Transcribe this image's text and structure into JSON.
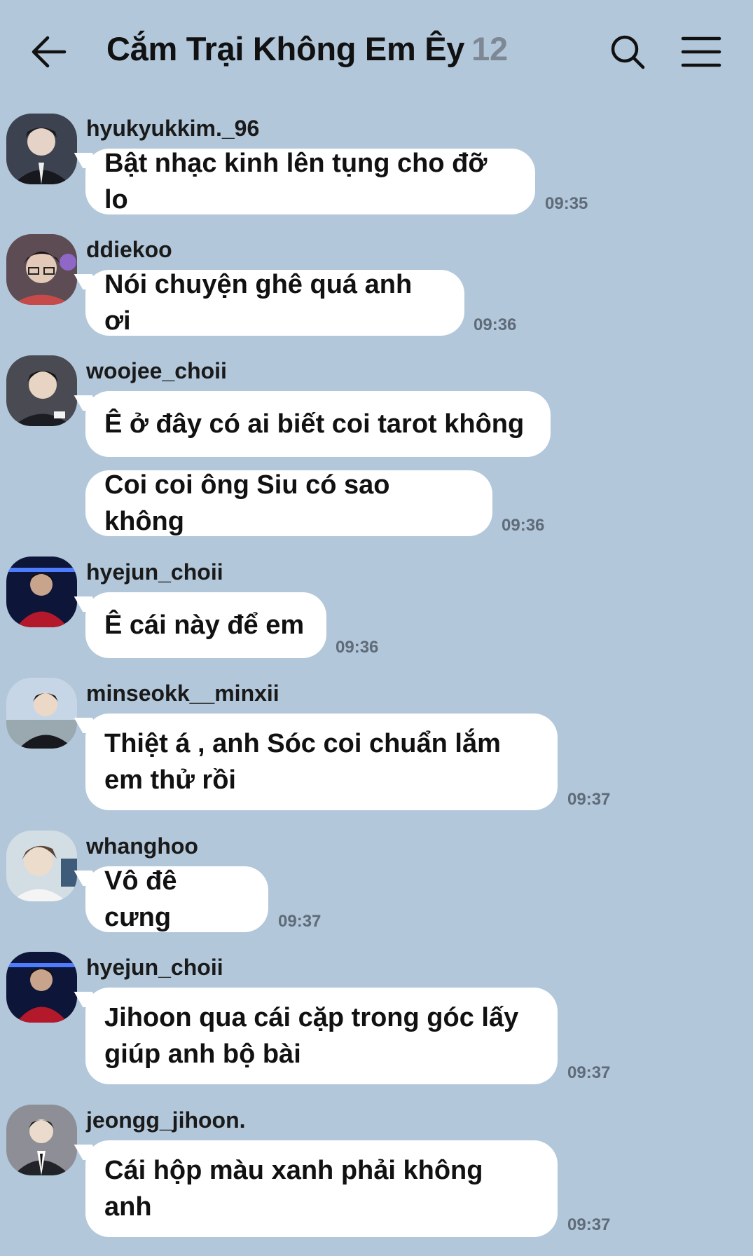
{
  "header": {
    "title": "Cắm Trại Không Em Êy",
    "member_count": "12",
    "back_icon": "arrow-left-icon",
    "search_icon": "search-icon",
    "menu_icon": "hamburger-menu-icon"
  },
  "messages": [
    {
      "user": "hyukyukkim._96",
      "text": "Bật nhạc kinh lên tụng cho đỡ lo",
      "time": "09:35"
    },
    {
      "user": "ddiekoo",
      "text": "Nói chuyện ghê quá anh ơi",
      "time": "09:36"
    },
    {
      "user": "woojee_choii",
      "text": "Ê ở đây có ai biết coi tarot không",
      "time": ""
    },
    {
      "user": "",
      "text": "Coi coi ông Siu có sao không",
      "time": "09:36"
    },
    {
      "user": "hyejun_choii",
      "text": "Ê cái này để em",
      "time": "09:36"
    },
    {
      "user": "minseokk__minxii",
      "text": "Thiệt á , anh Sóc coi chuẩn lắm\nem thử rồi",
      "time": "09:37"
    },
    {
      "user": "whanghoo",
      "text": "Vô đê cưng",
      "time": "09:37"
    },
    {
      "user": "hyejun_choii",
      "text": "Jihoon qua cái cặp trong góc lấy\ngiúp anh bộ bài",
      "time": "09:37"
    },
    {
      "user": "jeongg_jihoon.",
      "text": "Cái hộp màu xanh phải không\nanh",
      "time": "09:37"
    }
  ],
  "colors": {
    "background": "#b2c7da",
    "bubble": "#ffffff",
    "count": "#7d8894",
    "time": "#5f6b78"
  }
}
